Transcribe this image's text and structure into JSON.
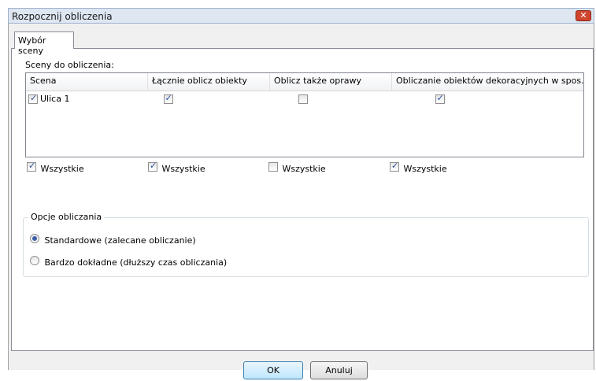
{
  "window": {
    "title": "Rozpocznij obliczenia",
    "close_glyph": "✕"
  },
  "tabs": [
    {
      "label": "Wybór sceny"
    }
  ],
  "scenes_section": {
    "label": "Sceny do obliczenia:"
  },
  "grid": {
    "columns": [
      "Scena",
      "Łącznie oblicz obiekty",
      "Oblicz także oprawy",
      "Obliczanie obiektów dekoracyjnych w spos..."
    ],
    "rows": [
      {
        "name": "Ulica 1",
        "selected": true,
        "calc_objects": true,
        "calc_luminaires": false,
        "calc_decor": true
      }
    ]
  },
  "select_all": [
    {
      "label": "Wszystkie",
      "checked": true
    },
    {
      "label": "Wszystkie",
      "checked": true
    },
    {
      "label": "Wszystkie",
      "checked": false
    },
    {
      "label": "Wszystkie",
      "checked": true
    }
  ],
  "options": {
    "title": "Opcje obliczania",
    "items": [
      {
        "label": "Standardowe (zalecane obliczanie)",
        "selected": true
      },
      {
        "label": "Bardzo dokładne (dłuższy czas obliczania)",
        "selected": false
      }
    ]
  },
  "buttons": {
    "ok": "OK",
    "cancel": "Anuluj"
  }
}
